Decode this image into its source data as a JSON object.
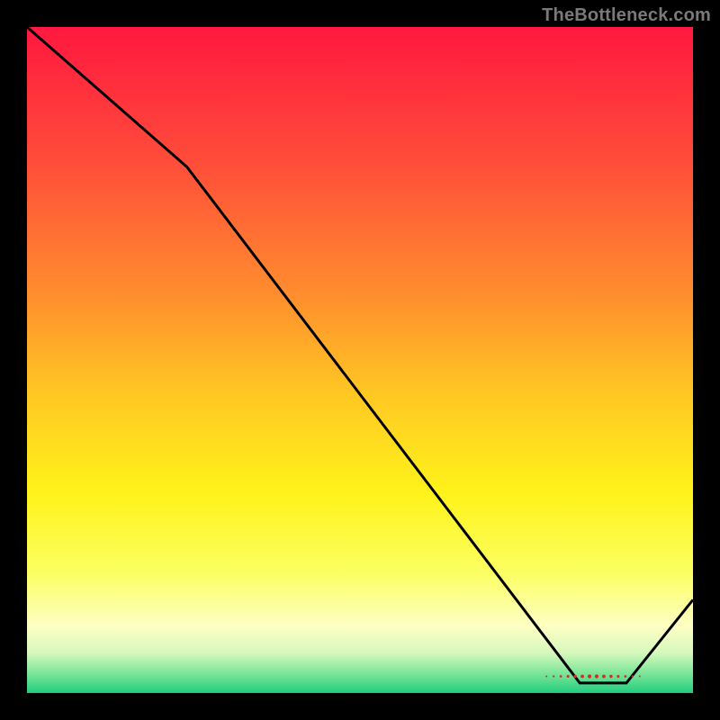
{
  "attribution": "TheBottleneck.com",
  "chart_data": {
    "type": "line",
    "title": "",
    "xlabel": "",
    "ylabel": "",
    "xlim": [
      0,
      100
    ],
    "ylim": [
      0,
      100
    ],
    "background": {
      "type": "vertical-gradient",
      "stops": [
        {
          "pos": 0.0,
          "color": "#ff183f"
        },
        {
          "pos": 0.2,
          "color": "#ff4c3a"
        },
        {
          "pos": 0.4,
          "color": "#ff8d2e"
        },
        {
          "pos": 0.55,
          "color": "#ffc723"
        },
        {
          "pos": 0.7,
          "color": "#fff31a"
        },
        {
          "pos": 0.82,
          "color": "#fbff62"
        },
        {
          "pos": 0.9,
          "color": "#feffc4"
        },
        {
          "pos": 0.94,
          "color": "#d6f8bd"
        },
        {
          "pos": 0.97,
          "color": "#7de699"
        },
        {
          "pos": 1.0,
          "color": "#21cd7e"
        }
      ]
    },
    "series": [
      {
        "name": "bottleneck-curve",
        "color": "#000000",
        "points": [
          {
            "x": 0,
            "y": 100
          },
          {
            "x": 24,
            "y": 79
          },
          {
            "x": 83,
            "y": 1.5
          },
          {
            "x": 90,
            "y": 1.5
          },
          {
            "x": 100,
            "y": 14
          }
        ]
      }
    ],
    "marker": {
      "name": "optimal-region",
      "color": "#d03028",
      "x_start": 78,
      "x_end": 92,
      "y": 2.5
    }
  }
}
